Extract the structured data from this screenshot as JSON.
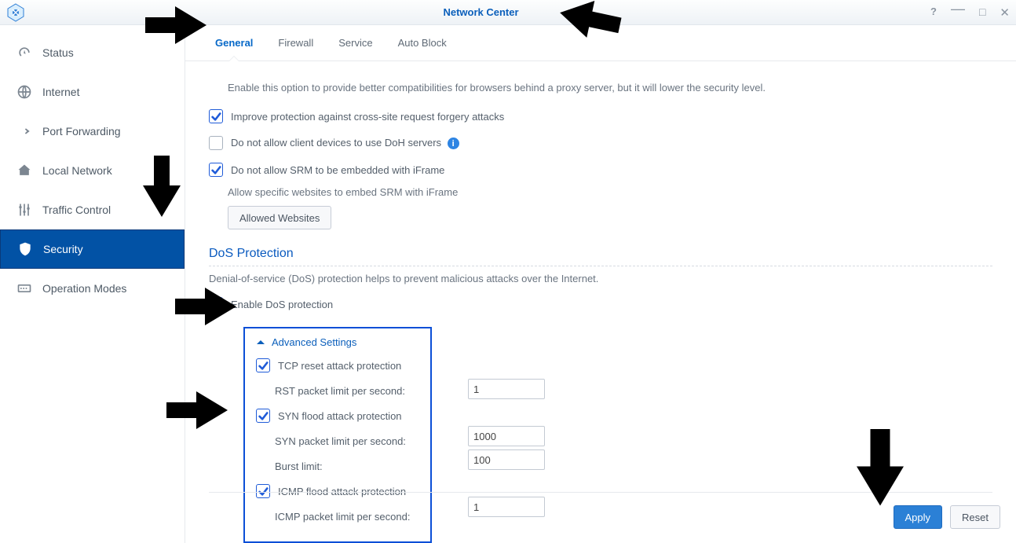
{
  "window": {
    "title": "Network Center"
  },
  "sidebar": {
    "items": [
      {
        "label": "Status"
      },
      {
        "label": "Internet"
      },
      {
        "label": "Port Forwarding"
      },
      {
        "label": "Local Network"
      },
      {
        "label": "Traffic Control"
      },
      {
        "label": "Security"
      },
      {
        "label": "Operation Modes"
      }
    ]
  },
  "tabs": {
    "items": [
      {
        "label": "General"
      },
      {
        "label": "Firewall"
      },
      {
        "label": "Service"
      },
      {
        "label": "Auto Block"
      }
    ]
  },
  "general": {
    "proxy_note": "Enable this option to provide better compatibilities for browsers behind a proxy server, but it will lower the security level.",
    "opt_csrf": "Improve protection against cross-site request forgery attacks",
    "opt_doh": "Do not allow client devices to use DoH servers",
    "opt_iframe": "Do not allow SRM to be embedded with iFrame",
    "iframe_note": "Allow specific websites to embed SRM with iFrame",
    "allowed_btn": "Allowed Websites"
  },
  "dos": {
    "heading": "DoS Protection",
    "desc": "Denial-of-service (DoS) protection helps to prevent malicious attacks over the Internet.",
    "enable": "Enable DoS protection",
    "adv_title": "Advanced Settings",
    "tcp_reset": "TCP reset attack protection",
    "rst_label": "RST packet limit per second:",
    "rst_value": "1",
    "syn_flood": "SYN flood attack protection",
    "syn_label": "SYN packet limit per second:",
    "syn_value": "1000",
    "burst_label": "Burst limit:",
    "burst_value": "100",
    "icmp_flood": "ICMP flood attack protection",
    "icmp_label": "ICMP packet limit per second:",
    "icmp_value": "1"
  },
  "actions": {
    "apply": "Apply",
    "reset": "Reset"
  }
}
